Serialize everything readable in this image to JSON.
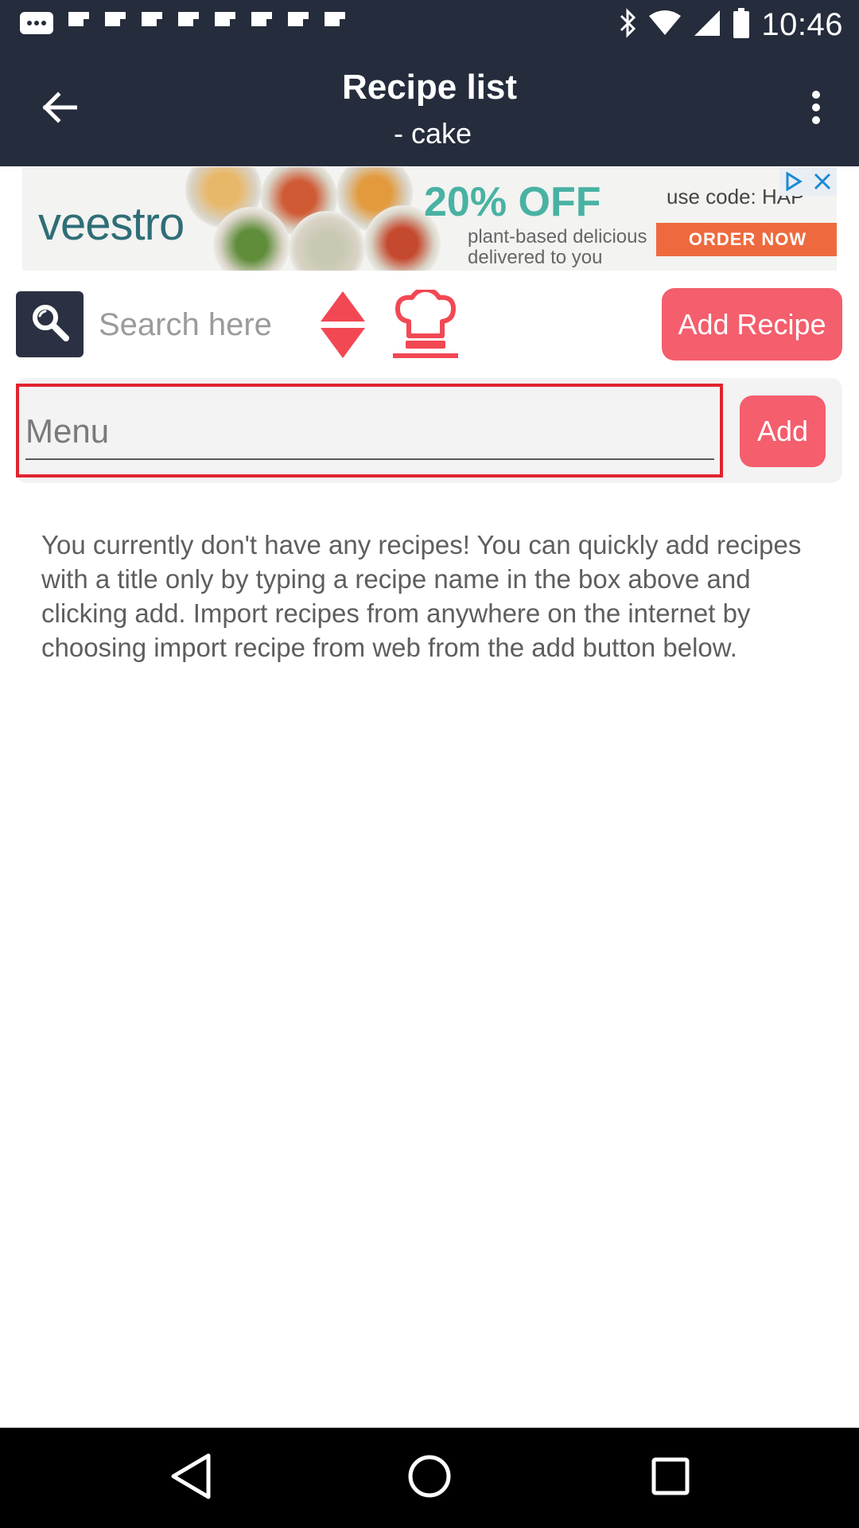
{
  "status_bar": {
    "time": "10:46",
    "left_icons": [
      "message-icon",
      "flipboard-icon",
      "flipboard-icon",
      "flipboard-icon",
      "flipboard-icon",
      "flipboard-icon",
      "flipboard-icon",
      "flipboard-icon",
      "flipboard-icon"
    ],
    "right_icons": [
      "bluetooth-icon",
      "wifi-icon",
      "signal-icon",
      "battery-icon"
    ]
  },
  "app_bar": {
    "title": "Recipe list",
    "subtitle": "- cake",
    "back_icon": "arrow-back-icon",
    "more_icon": "more-vert-icon",
    "background": "#252c3c"
  },
  "ad": {
    "brand": "veestro",
    "offer": "20% OFF",
    "code": "use code: HAP",
    "line1": "plant-based delicious",
    "line2": "delivered to you",
    "cta": "ORDER NOW"
  },
  "toolbar": {
    "search_placeholder": "Search here",
    "search_icon": "search-icon",
    "sort_icon": "sort-updown-icon",
    "chef_icon": "chef-hat-icon",
    "add_recipe_label": "Add Recipe"
  },
  "quick_add": {
    "placeholder": "Menu",
    "value": "",
    "add_label": "Add"
  },
  "empty_message": "You currently don't have any recipes! You can quickly add recipes with a title only by typing a recipe name in the box above and clicking add. Import recipes from anywhere on the internet by choosing import recipe from web from the add button below.",
  "nav_bar": {
    "icons": [
      "back-triangle-icon",
      "home-circle-icon",
      "recents-square-icon"
    ]
  },
  "colors": {
    "accent": "#f45e6d",
    "focus_border": "#e0242e",
    "dark": "#252c3c"
  }
}
